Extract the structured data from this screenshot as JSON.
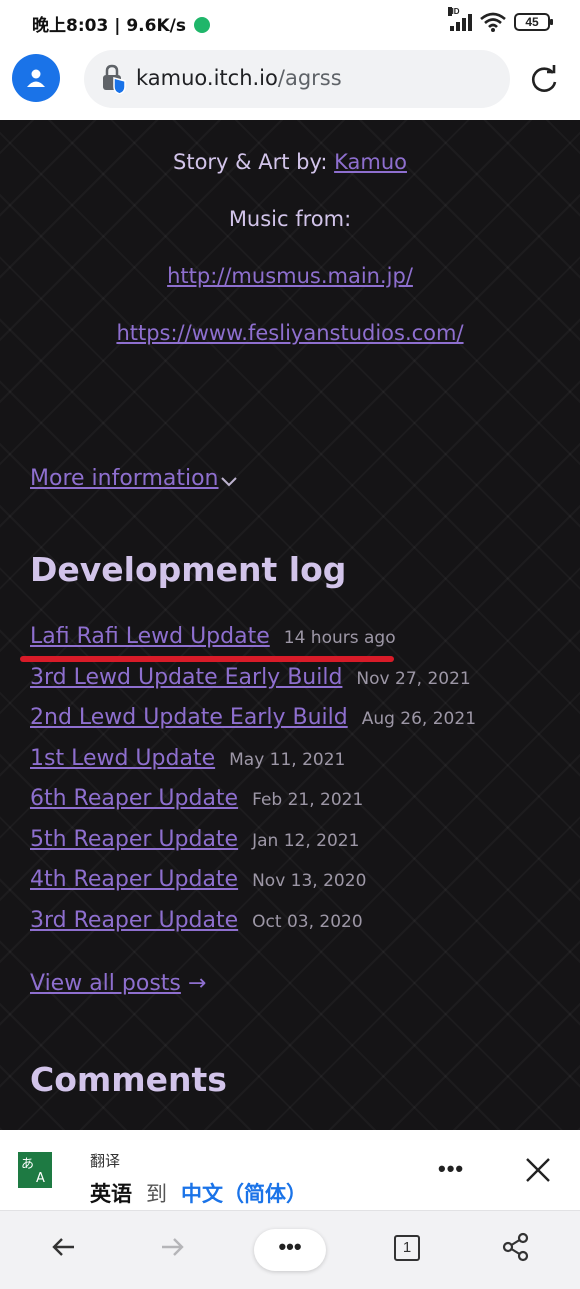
{
  "status_bar": {
    "time_speed": "晚上8:03 | 9.6K/s",
    "network": "HD",
    "battery": "45"
  },
  "url_bar": {
    "domain": "kamuo.itch.io",
    "path": "/agrss"
  },
  "credits": {
    "story_label": "Story & Art by: ",
    "story_author": "Kamuo",
    "music_label": "Music from:",
    "music_link_1": "http://musmus.main.jp/",
    "music_link_2": "https://www.fesliyanstudios.com/"
  },
  "more_info": {
    "label": "More information"
  },
  "dev_log": {
    "title": "Development log",
    "posts": [
      {
        "title": "Lafi Rafi Lewd Update",
        "date": "14 hours ago"
      },
      {
        "title": "3rd Lewd Update Early Build",
        "date": "Nov 27, 2021"
      },
      {
        "title": "2nd Lewd Update Early Build",
        "date": "Aug 26, 2021"
      },
      {
        "title": "1st Lewd Update",
        "date": "May 11, 2021"
      },
      {
        "title": "6th Reaper Update",
        "date": "Feb 21, 2021"
      },
      {
        "title": "5th Reaper Update",
        "date": "Jan 12, 2021"
      },
      {
        "title": "4th Reaper Update",
        "date": "Nov 13, 2020"
      },
      {
        "title": "3rd Reaper Update",
        "date": "Oct 03, 2020"
      }
    ],
    "view_all": "View all posts",
    "view_all_arrow": "→"
  },
  "comments": {
    "title": "Comments"
  },
  "translate_bar": {
    "label": "翻译",
    "from_lang": "英语",
    "to_word": "到",
    "target_lang": "中文（简体）",
    "more": "•••"
  },
  "bottom_nav": {
    "menu": "•••",
    "tab_count": "1"
  },
  "colors": {
    "page_bg": "#151416",
    "link": "#8e6fcf",
    "heading": "#d2c4ea",
    "date": "#9d97a6",
    "highlight": "#d81b28",
    "accent": "#1a73e8"
  }
}
